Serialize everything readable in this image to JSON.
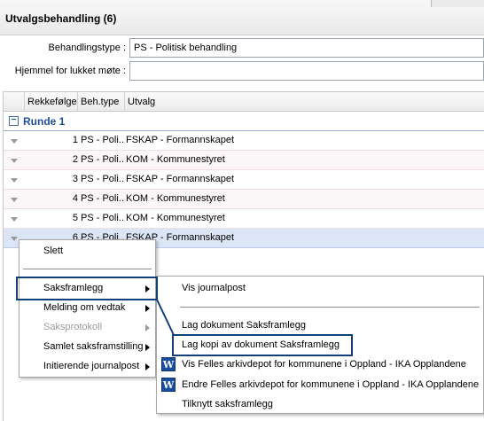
{
  "window": {
    "title": "Utvalgsbehandling (6)"
  },
  "form": {
    "behandlingstype_label": "Behandlingstype :",
    "behandlingstype_value": "PS - Politisk behandling",
    "hjemmel_label": "Hjemmel for lukket møte :",
    "hjemmel_value": ""
  },
  "grid": {
    "columns": [
      "Rekkefølge",
      "Beh.type",
      "Utvalg"
    ],
    "group": {
      "toggle": "−",
      "label": "Runde 1"
    },
    "rows": [
      {
        "order": "1",
        "type": "PS - Poli...",
        "utvalg": "FSKAP - Formannskapet"
      },
      {
        "order": "2",
        "type": "PS - Poli...",
        "utvalg": "KOM - Kommunestyret"
      },
      {
        "order": "3",
        "type": "PS - Poli...",
        "utvalg": "FSKAP - Formannskapet"
      },
      {
        "order": "4",
        "type": "PS - Poli...",
        "utvalg": "KOM - Kommunestyret"
      },
      {
        "order": "5",
        "type": "PS - Poli...",
        "utvalg": "KOM - Kommunestyret"
      },
      {
        "order": "6",
        "type": "PS - Poli...",
        "utvalg": "FSKAP - Formannskapet"
      }
    ]
  },
  "context_menu": {
    "items": [
      {
        "label": "Slett"
      },
      {
        "label": "Saksframlegg"
      },
      {
        "label": "Melding om vedtak"
      },
      {
        "label": "Saksprotokoll"
      },
      {
        "label": "Samlet saksframstilling"
      },
      {
        "label": "Initierende journalpost"
      }
    ]
  },
  "submenu": {
    "word_icon": "W",
    "items": [
      {
        "label": "Vis journalpost"
      },
      {
        "label": "Lag dokument Saksframlegg"
      },
      {
        "label": "Lag kopi av dokument Saksframlegg"
      },
      {
        "label": "Vis Felles arkivdepot for kommunene i Oppland - IKA Opplandene"
      },
      {
        "label": "Endre Felles arkivdepot for kommunene i Oppland - IKA Opplandene"
      },
      {
        "label": "Tilknytt saksframlegg"
      }
    ]
  },
  "colors": {
    "accent": "#1f4f9a",
    "highlight_border": "#123f78",
    "selected_row": "#dbe5f5"
  }
}
